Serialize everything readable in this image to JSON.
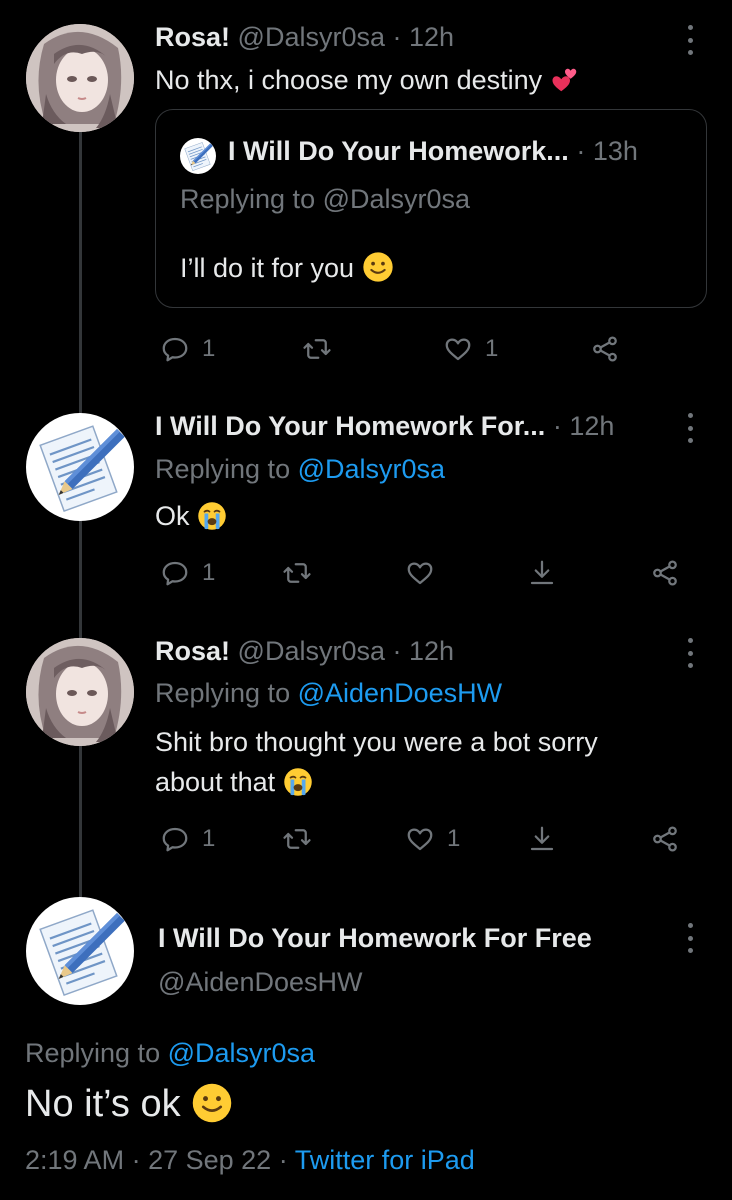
{
  "tweets": [
    {
      "name": "Rosa!",
      "handle": "@Dalsyr0sa",
      "sep": "·",
      "time": "12h",
      "text": "No thx, i choose my own destiny",
      "quote": {
        "name": "I Will Do Your Homework...",
        "sep": "·",
        "time": "13h",
        "replying_prefix": "Replying to",
        "replying_handle": "@Dalsyr0sa",
        "text": "I’ll do it for you"
      },
      "replies": "1",
      "likes": "1"
    },
    {
      "name": "I Will Do Your Homework For...",
      "sep": "·",
      "time": "12h",
      "replying_prefix": "Replying to",
      "replying_handle": "@Dalsyr0sa",
      "text": "Ok",
      "replies": "1"
    },
    {
      "name": "Rosa!",
      "handle": "@Dalsyr0sa",
      "sep": "·",
      "time": "12h",
      "replying_prefix": "Replying to",
      "replying_handle": "@AidenDoesHW",
      "text_line1": "Shit bro thought you were a bot sorry",
      "text_line2": "about that",
      "replies": "1",
      "likes": "1"
    }
  ],
  "main": {
    "name": "I Will Do Your Homework For Free",
    "handle": "@AidenDoesHW",
    "replying_prefix": "Replying to",
    "replying_handle": "@Dalsyr0sa",
    "text": "No it’s ok",
    "time": "2:19 AM",
    "sep1": "·",
    "date": "27 Sep 22",
    "sep2": "·",
    "source": "Twitter for iPad"
  },
  "icons": {
    "reply": "speech-bubble-icon",
    "retweet": "retweet-icon",
    "like": "heart-icon",
    "bookmark": "download-icon",
    "share": "share-nodes-icon",
    "more": "vertical-dots-icon",
    "emoji_hearts": "two-hearts-icon",
    "emoji_smile": "slightly-smiling-face-icon",
    "emoji_cry": "loudly-crying-face-icon"
  },
  "colors": {
    "background": "#000000",
    "text": "#e7e9ea",
    "muted": "#71767b",
    "link": "#1d9bf0",
    "border": "#333639"
  }
}
